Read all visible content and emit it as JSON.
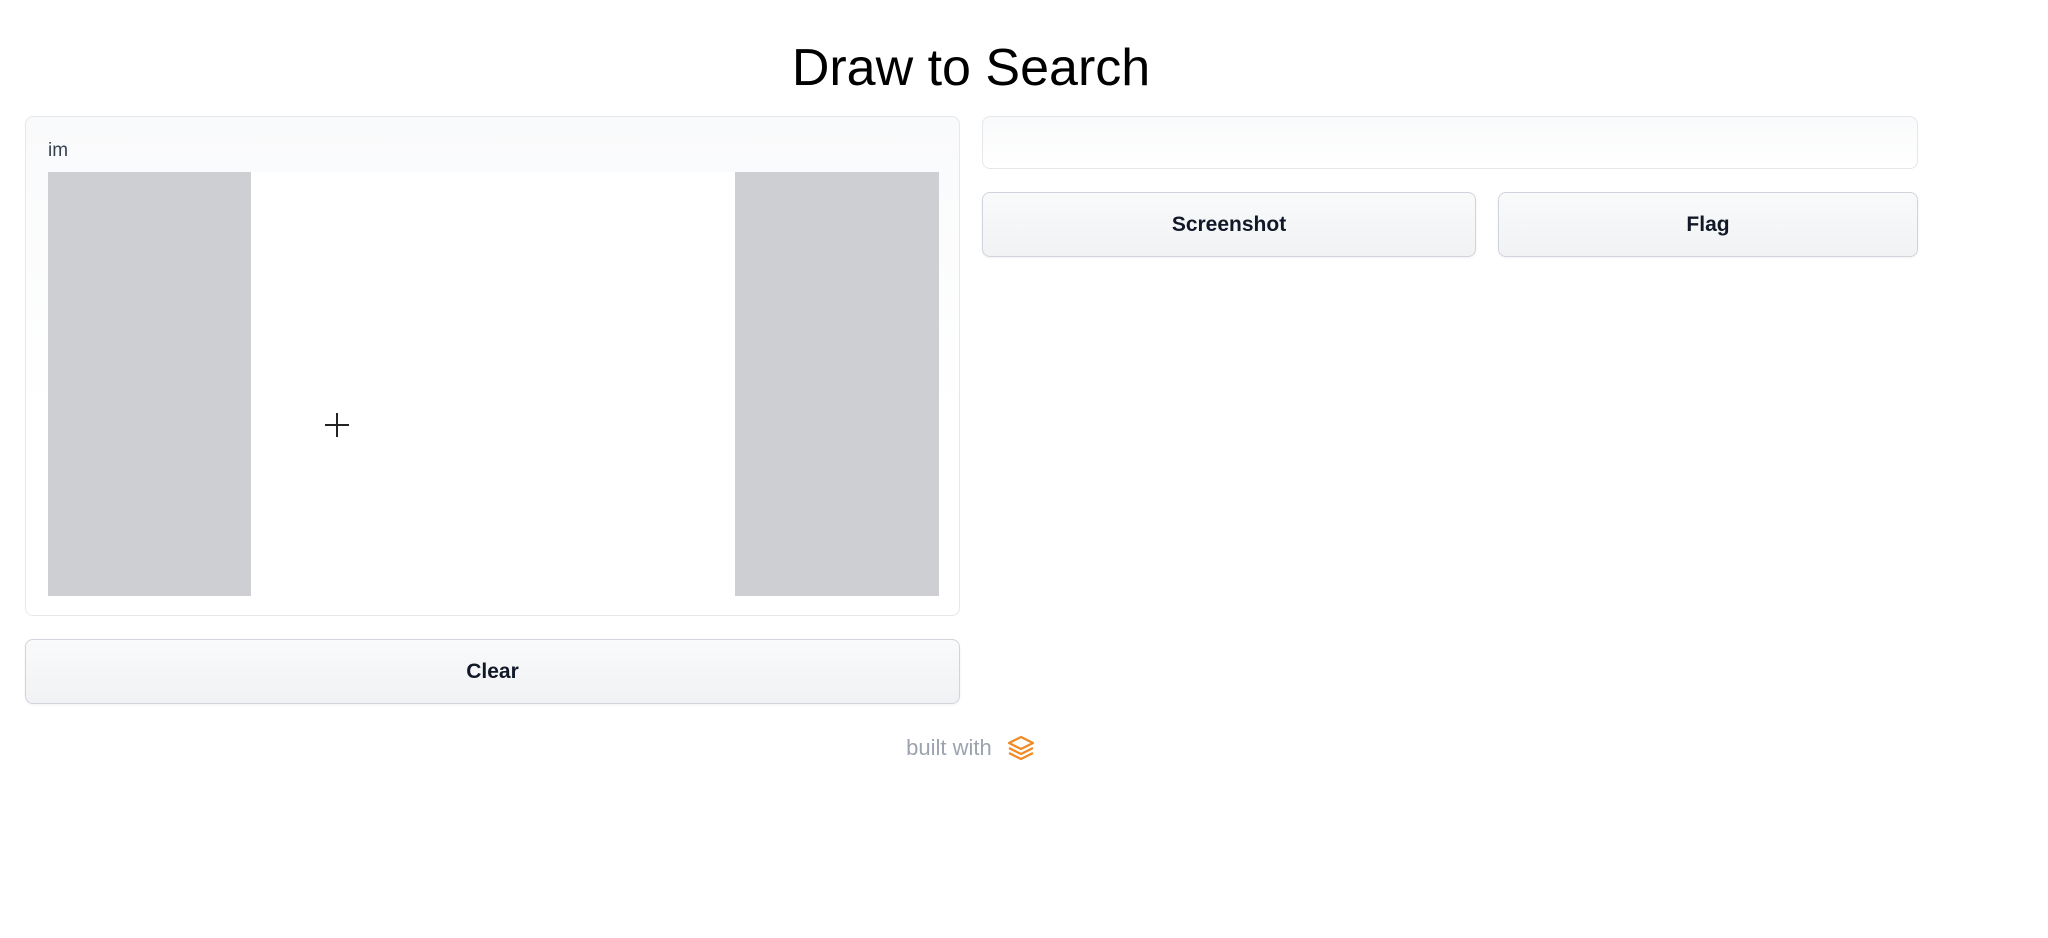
{
  "page": {
    "title": "Draw to Search"
  },
  "sketch_panel": {
    "label": "im"
  },
  "buttons": {
    "clear_label": "Clear",
    "screenshot_label": "Screenshot",
    "flag_label": "Flag"
  },
  "output": {
    "value": ""
  },
  "footer": {
    "text": "built with",
    "logo_icon": "gradio-logo-icon",
    "logo_color": "#f08a24"
  }
}
